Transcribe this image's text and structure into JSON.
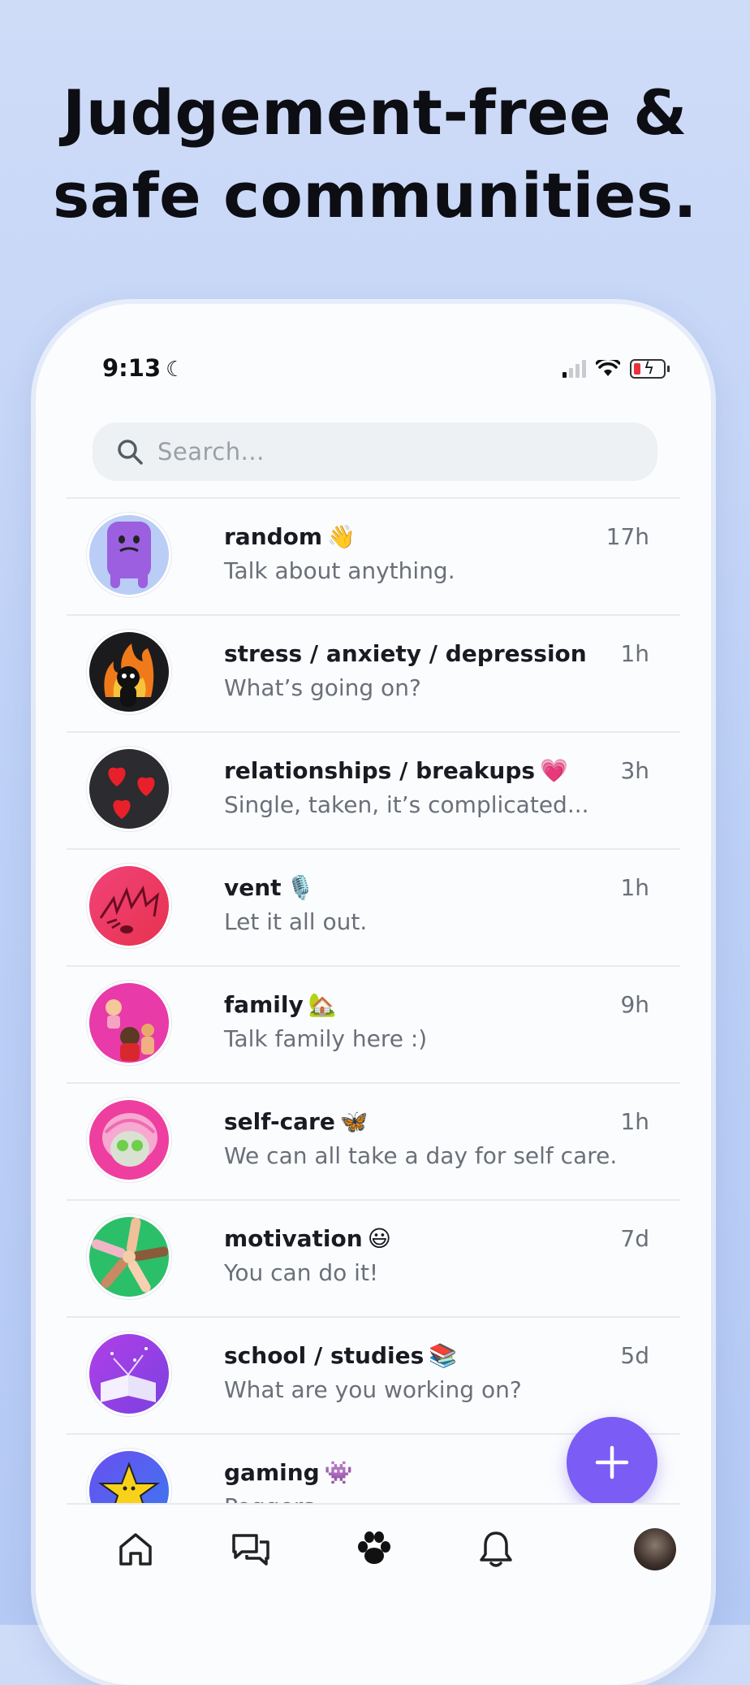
{
  "headline": {
    "line1": "Judgement-free &",
    "line2": "safe communities."
  },
  "status_bar": {
    "time": "9:13"
  },
  "search": {
    "placeholder": "Search..."
  },
  "communities": [
    {
      "name": "random",
      "emoji": "👋",
      "subtitle": "Talk about anything.",
      "time": "17h",
      "avatar_icon": "purple-creature-icon"
    },
    {
      "name": "stress / anxiety / depression",
      "emoji": "",
      "subtitle": "What’s going on?",
      "time": "1h",
      "avatar_icon": "fire-person-icon"
    },
    {
      "name": "relationships / breakups",
      "emoji": "💗",
      "subtitle": "Single, taken, it’s complicated...",
      "time": "3h",
      "avatar_icon": "hearts-icon"
    },
    {
      "name": "vent",
      "emoji": "🎙️",
      "subtitle": "Let it all out.",
      "time": "1h",
      "avatar_icon": "screaming-face-icon"
    },
    {
      "name": "family",
      "emoji": "🏡",
      "subtitle": "Talk family here :)",
      "time": "9h",
      "avatar_icon": "family-icon"
    },
    {
      "name": "self-care",
      "emoji": "🦋",
      "subtitle": "We can all take a day for self care.",
      "time": "1h",
      "avatar_icon": "face-mask-icon"
    },
    {
      "name": "motivation",
      "emoji": "😃",
      "subtitle": "You can do it!",
      "time": "7d",
      "avatar_icon": "hands-together-icon"
    },
    {
      "name": "school / studies",
      "emoji": "📚",
      "subtitle": "What are you working on?",
      "time": "5d",
      "avatar_icon": "open-book-icon"
    },
    {
      "name": "gaming",
      "emoji": "👾",
      "subtitle": "Poggers.",
      "time": "",
      "avatar_icon": "star-icon"
    }
  ],
  "colors": {
    "accent": "#7b5cf4",
    "background": "#c4d5f7"
  },
  "nav": {
    "items": [
      "home-icon",
      "chat-icon",
      "paw-icon",
      "bell-icon",
      "profile-avatar"
    ]
  }
}
